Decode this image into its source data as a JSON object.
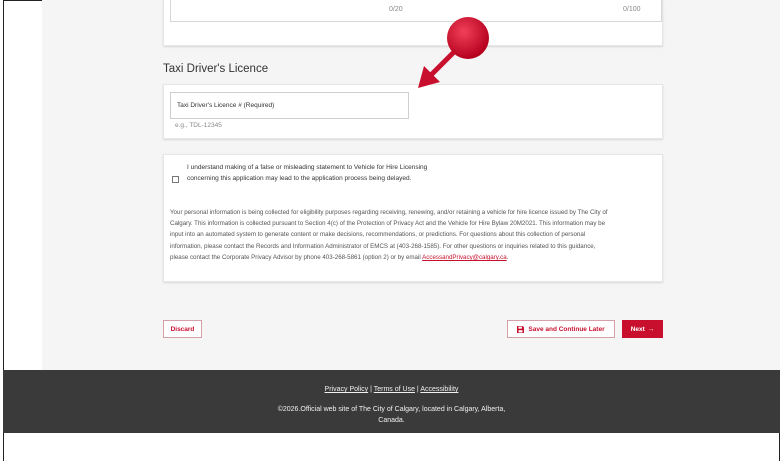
{
  "top_section": {
    "counter_left": "0/20",
    "counter_right": "0/100"
  },
  "licence": {
    "title": "Taxi Driver's Licence",
    "field_label": "Taxi Driver's Licence # (Required)",
    "hint": "e.g., TDL-12345"
  },
  "declaration": {
    "checkbox_text": "I understand making of a false or misleading statement to Vehicle for Hire Licensing concerning this application may lead to the application process being delayed.",
    "privacy_text": "Your personal information is being collected for eligibility purposes regarding receiving, renewing, and/or retaining a vehicle for hire licence issued by The City of Calgary. This information is collected pursuant to Section 4(c) of the Protection of Privacy Act and the Vehicle for Hire Bylaw 20M2021. This information may be input into an automated system to generate content or make decisions, recommendations, or predictions. For questions about this collection of personal information, please contact the Records and Information Administrator of EMCS at (403-268-1585). For other questions or inquiries related to this guidance, please contact the Corporate Privacy Advisor by phone 403-268-5861 (option 2) or by email ",
    "privacy_email": "AccessandPrivacy@calgary.ca",
    "privacy_end": "."
  },
  "actions": {
    "discard": "Discard",
    "save": "Save and Continue Later",
    "next": "Next",
    "save_icon": "floppy-disk-icon",
    "next_icon": "arrow-right-icon"
  },
  "footer": {
    "privacy_policy": "Privacy Policy",
    "terms": "Terms of Use",
    "accessibility": "Accessibility",
    "separator": "|",
    "copyright": "©2026.Official web site of The City of Calgary, located in Calgary, Alberta, Canada."
  },
  "colors": {
    "accent": "#c8102e",
    "footer_bg": "#3a3a3a",
    "page_bg": "#f5f5f5"
  }
}
